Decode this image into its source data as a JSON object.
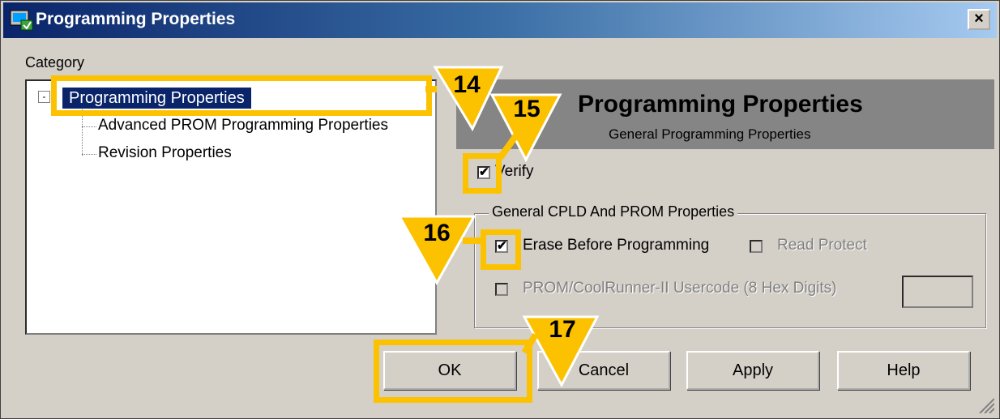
{
  "window": {
    "title": "Programming Properties",
    "close_glyph": "×",
    "icon": "app-icon"
  },
  "category": {
    "label": "Category",
    "tree": {
      "expander_glyph": "-",
      "items": [
        {
          "label": "Programming Properties",
          "selected": true
        },
        {
          "label": "Advanced PROM Programming Properties",
          "selected": false
        },
        {
          "label": "Revision Properties",
          "selected": false
        }
      ]
    }
  },
  "panel": {
    "title": "Programming Properties",
    "subtitle": "General Programming Properties",
    "verify": {
      "label": "Verify",
      "checked": true,
      "mark": "✔"
    },
    "group": {
      "legend": "General CPLD And PROM Properties",
      "erase_before_programming": {
        "label": "Erase Before Programming",
        "checked": true,
        "enabled": true,
        "mark": "✔"
      },
      "read_protect": {
        "label": "Read Protect",
        "checked": false,
        "enabled": false
      },
      "usercode": {
        "label": "PROM/CoolRunner-II Usercode (8 Hex Digits)",
        "checked": false,
        "enabled": false,
        "value": ""
      }
    }
  },
  "buttons": {
    "ok": "OK",
    "cancel": "Cancel",
    "apply": "Apply",
    "help": "Help"
  },
  "callouts": [
    {
      "number": "14"
    },
    {
      "number": "15"
    },
    {
      "number": "16"
    },
    {
      "number": "17"
    }
  ],
  "colors": {
    "highlight": "#fcc200",
    "titlebar_start": "#0a246a",
    "dialog_face": "#d4d0c8",
    "banner": "#858585"
  }
}
